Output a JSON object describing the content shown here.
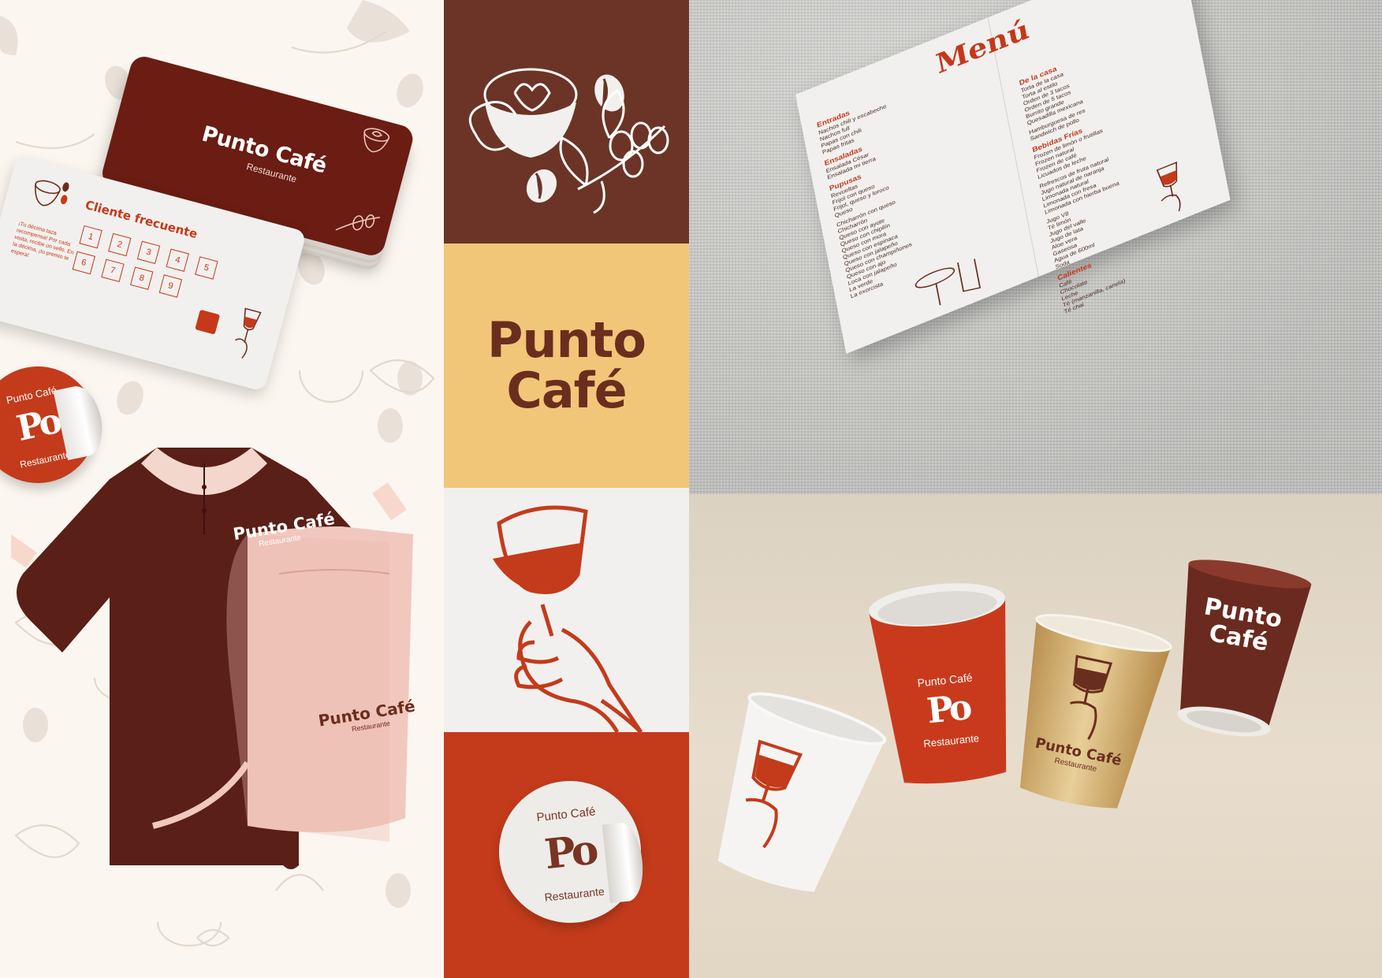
{
  "brand": {
    "name_line1": "Punto",
    "name_line2": "Café",
    "name_inline": "Punto Café",
    "tagline": "Restaurante",
    "monogram": "Po",
    "colors": {
      "dark_brown": "#6b3426",
      "rust": "#c33b1b",
      "mustard": "#f2c678",
      "off_white": "#f2f0ee",
      "deep_brown": "#6a2e1e"
    }
  },
  "loyalty_card": {
    "title": "Cliente frecuente",
    "stamps": [
      "1",
      "2",
      "3",
      "4",
      "5",
      "6",
      "7",
      "8",
      "9"
    ],
    "note": "¡Tu décima taza recompensa! Por cada visita, recibe un sello. En la décima, ¡tu premio te espera!"
  },
  "shirt": {
    "label": "Punto Café",
    "sub": "Restaurante"
  },
  "apron": {
    "label": "Punto Café",
    "sub": "Restaurante"
  },
  "menu": {
    "title": "Menú",
    "sections": [
      {
        "name": "Entradas",
        "items": [
          "Nachos chili y escabeche",
          "Nachos full",
          "Papas con chili",
          "Papas fritas"
        ]
      },
      {
        "name": "Ensaladas",
        "items": [
          "Ensalada César",
          "Ensalada mi tierra"
        ]
      },
      {
        "name": "Pupusas",
        "items": [
          "Revueltas",
          "Frijol con queso",
          "Frijol, queso y loroco",
          "Queso",
          "",
          "Chicharrón con queso",
          "Chicharrón",
          "Queso con ayote",
          "Queso con chipilín",
          "Queso con mora",
          "Queso con espinaca",
          "Queso con jalapeño",
          "Queso con champiñones",
          "Queso con ajo",
          "Loca con jalapeño",
          "La verde",
          "La exorcista"
        ]
      },
      {
        "name": "De la casa",
        "items": [
          "Torta de la casa",
          "Torta al estilo",
          "Orden de 3 tacos",
          "Orden de 5 tacos",
          "Burrito grande",
          "Quesadilla mexicana",
          "",
          "Hamburguesa de res",
          "Sandwich de pollo"
        ]
      },
      {
        "name": "Bebidas Frías",
        "items": [
          "Frozen de limón o frutillas",
          "Frozen natural",
          "Frozen de café",
          "Licuados de leche",
          "",
          "Refrescos de fruta natural",
          "Jugo natural de naranja",
          "Limonada natural",
          "Limonada con fresa",
          "Limonada con hierba buena",
          "",
          "Jugo V8",
          "Té limón",
          "Jugo del valle",
          "Jugo de lata",
          "Aloe vera",
          "Gaseosa",
          "Agua de 600ml",
          "Soda"
        ]
      },
      {
        "name": "Calientes",
        "items": [
          "Café",
          "Chocolate",
          "Leche",
          "Té (manzanilla, canela)",
          "Té chai"
        ]
      }
    ]
  },
  "cups": [
    {
      "style": "white",
      "label": ""
    },
    {
      "style": "red",
      "ring_top": "Punto Café",
      "monogram": "Po",
      "ring_bot": "Restaurante"
    },
    {
      "style": "gold",
      "label": "Punto Café",
      "sub": "Restaurante"
    },
    {
      "style": "brown",
      "label_line1": "Punto",
      "label_line2": "Café"
    }
  ],
  "icons": [
    "coffee-cup-heart-icon",
    "coffee-bean-icon",
    "coffee-branch-icon",
    "hand-wine-glass-icon",
    "cafe-table-icon"
  ]
}
